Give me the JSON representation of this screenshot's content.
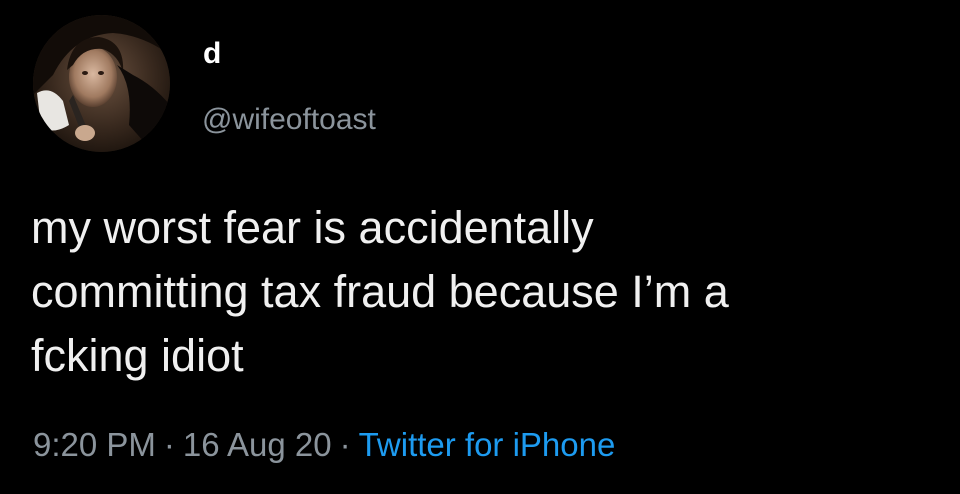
{
  "tweet": {
    "author": {
      "display_name": "d",
      "handle": "@wifeoftoast"
    },
    "text_lines": [
      "my worst fear is accidentally",
      "committing tax fraud because I’m a",
      "fcking idiot"
    ],
    "time": "9:20 PM",
    "date": "16 Aug 20",
    "separator": "·",
    "source": "Twitter for iPhone"
  },
  "colors": {
    "background": "#000000",
    "text": "#f0f0f0",
    "secondary": "#8b949c",
    "link": "#1d9bf0"
  }
}
